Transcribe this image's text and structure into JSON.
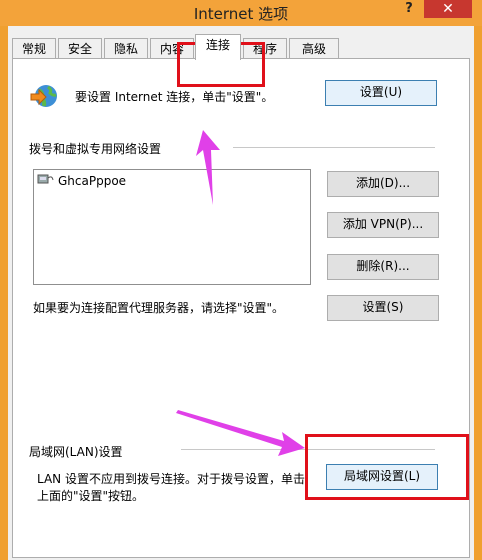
{
  "window": {
    "title": "Internet 选项",
    "help": "?",
    "close": "✕"
  },
  "tabs": [
    "常规",
    "安全",
    "隐私",
    "内容",
    "连接",
    "程序",
    "高级"
  ],
  "active_tab": "连接",
  "setup": {
    "text": "要设置 Internet 连接，单击\"设置\"。",
    "button": "设置(U)"
  },
  "dialup": {
    "heading": "拨号和虚拟专用网络设置",
    "items": [
      "GhcaPppoe"
    ],
    "add_button": "添加(D)...",
    "add_vpn_button": "添加 VPN(P)...",
    "remove_button": "删除(R)...",
    "proxy_text": "如果要为连接配置代理服务器，请选择\"设置\"。",
    "settings_button": "设置(S)"
  },
  "lan": {
    "heading": "局域网(LAN)设置",
    "desc_line1": "LAN 设置不应用到拨号连接。对于拨号设置，单击",
    "desc_line2": "上面的\"设置\"按钮。",
    "button": "局域网设置(L)"
  },
  "colors": {
    "highlight": "#e0101a",
    "arrow": "#e040e8",
    "title_bg": "#f3a33a"
  }
}
